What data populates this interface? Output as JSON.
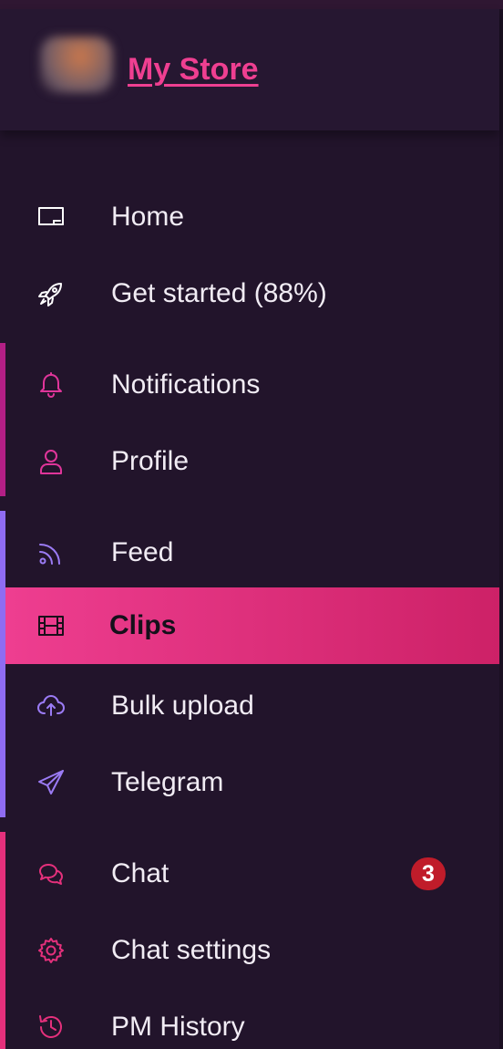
{
  "store": {
    "name": "My Store"
  },
  "colors": {
    "background": "#22142b",
    "accent_pink": "#ef3f91",
    "group_magenta": "#b41f86",
    "group_purple": "#8f6cf2",
    "group_pink": "#e5307c",
    "badge_red": "#c01c2a"
  },
  "nav": {
    "home": {
      "label": "Home",
      "icon": "monitor-icon"
    },
    "get_started": {
      "label": "Get started (88%)",
      "icon": "rocket-icon"
    },
    "notifications": {
      "label": "Notifications",
      "icon": "bell-icon"
    },
    "profile": {
      "label": "Profile",
      "icon": "user-icon"
    },
    "feed": {
      "label": "Feed",
      "icon": "rss-icon"
    },
    "clips": {
      "label": "Clips",
      "icon": "film-icon",
      "active": true
    },
    "bulk_upload": {
      "label": "Bulk upload",
      "icon": "cloud-upload-icon"
    },
    "telegram": {
      "label": "Telegram",
      "icon": "send-icon"
    },
    "chat": {
      "label": "Chat",
      "icon": "chat-bubbles-icon",
      "badge": "3"
    },
    "chat_settings": {
      "label": "Chat settings",
      "icon": "gear-icon"
    },
    "pm_history": {
      "label": "PM History",
      "icon": "history-icon"
    }
  }
}
